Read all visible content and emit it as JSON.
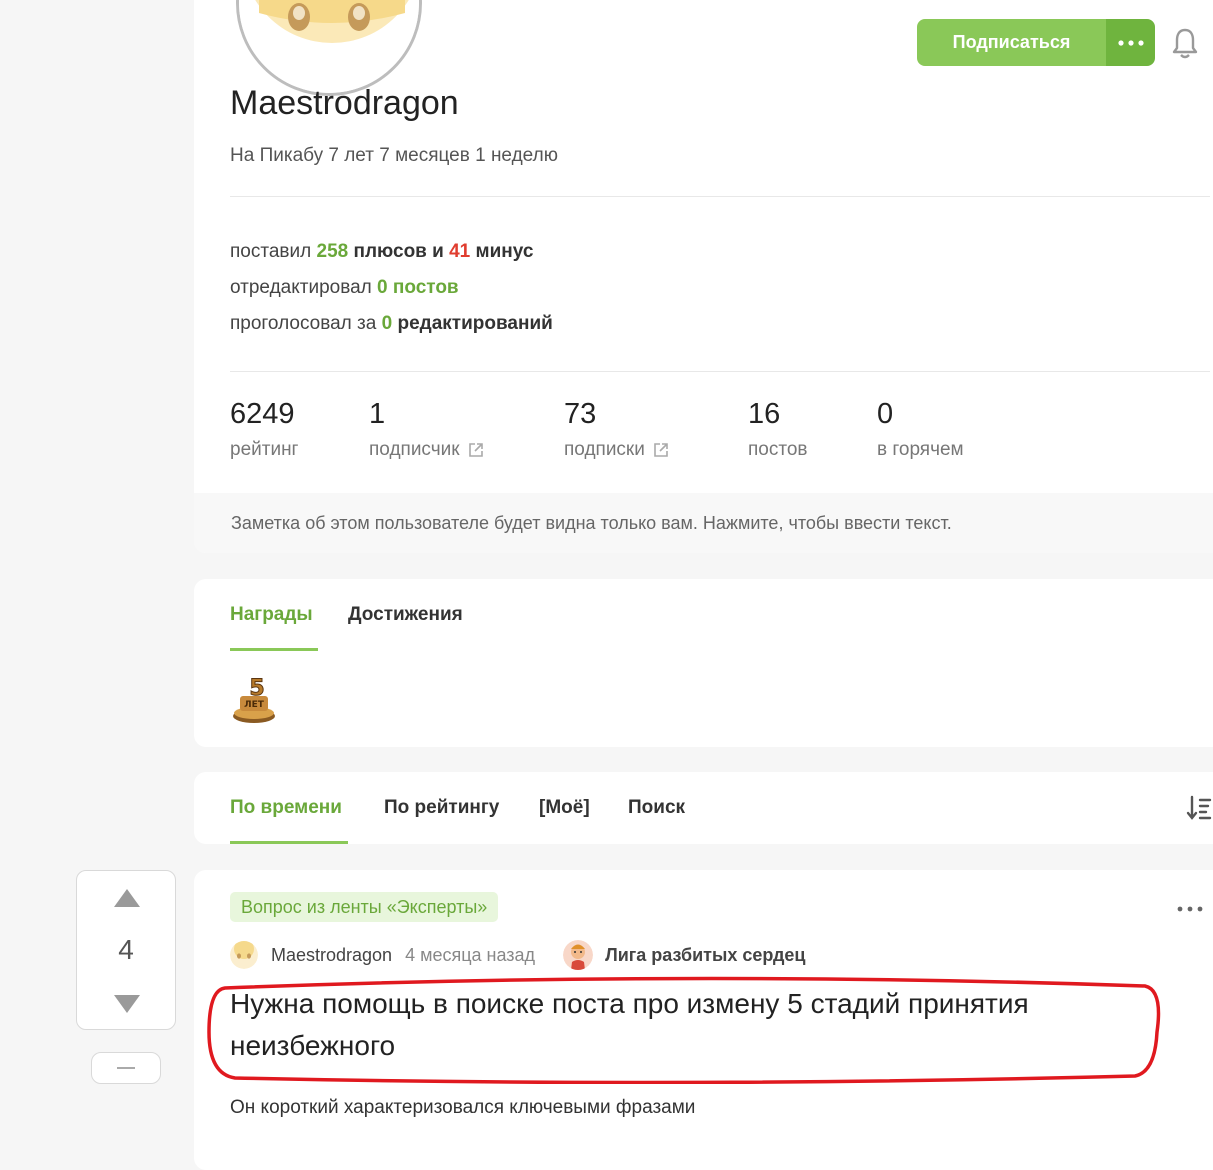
{
  "header": {
    "subscribe_label": "Подписаться",
    "more_icon": "dots-horizontal-icon",
    "bell_icon": "bell-icon"
  },
  "profile": {
    "username": "Maestrodragon",
    "member_since": "На Пикабу 7 лет 7 месяцев 1 неделю",
    "activity": {
      "line1_prefix": "поставил",
      "plus_count": "258",
      "plus_word": "плюсов и",
      "minus_count": "41",
      "minus_word": "минус",
      "line2_prefix": "отредактировал",
      "edited_count": "0",
      "edited_word": "постов",
      "line3_prefix": "проголосовал за",
      "voted_count": "0",
      "voted_word": "редактирований"
    },
    "counters": [
      {
        "value": "6249",
        "label": "рейтинг"
      },
      {
        "value": "1",
        "label": "подписчик"
      },
      {
        "value": "73",
        "label": "подписки"
      },
      {
        "value": "16",
        "label": "постов"
      },
      {
        "value": "0",
        "label": "в горячем"
      }
    ],
    "note_placeholder": "Заметка об этом пользователе будет видна только вам. Нажмите, чтобы ввести текст."
  },
  "awards": {
    "tabs": [
      {
        "label": "Награды",
        "active": true
      },
      {
        "label": "Достижения",
        "active": false
      }
    ],
    "badge_icon": "five-years-award-icon",
    "badge_text": "5 ЛЕТ"
  },
  "sort": {
    "tabs": [
      {
        "label": "По времени",
        "active": true
      },
      {
        "label": "По рейтингу",
        "active": false
      },
      {
        "label": "[Моё]",
        "active": false
      },
      {
        "label": "Поиск",
        "active": false
      }
    ],
    "sort_icon": "sort-order-icon"
  },
  "post": {
    "rating": "4",
    "tag": "Вопрос из ленты «Эксперты»",
    "author": "Maestrodragon",
    "time": "4 месяца назад",
    "community": "Лига разбитых сердец",
    "title": "Нужна помощь в поиске поста про измену 5 стадий принятия неизбежного",
    "excerpt": "Он короткий характеризовался ключевыми фразами"
  },
  "colors": {
    "accent_green": "#8ac858",
    "text_green": "#6aa83a",
    "minus_red": "#e03d2f",
    "annotation_red": "#e0191f"
  }
}
